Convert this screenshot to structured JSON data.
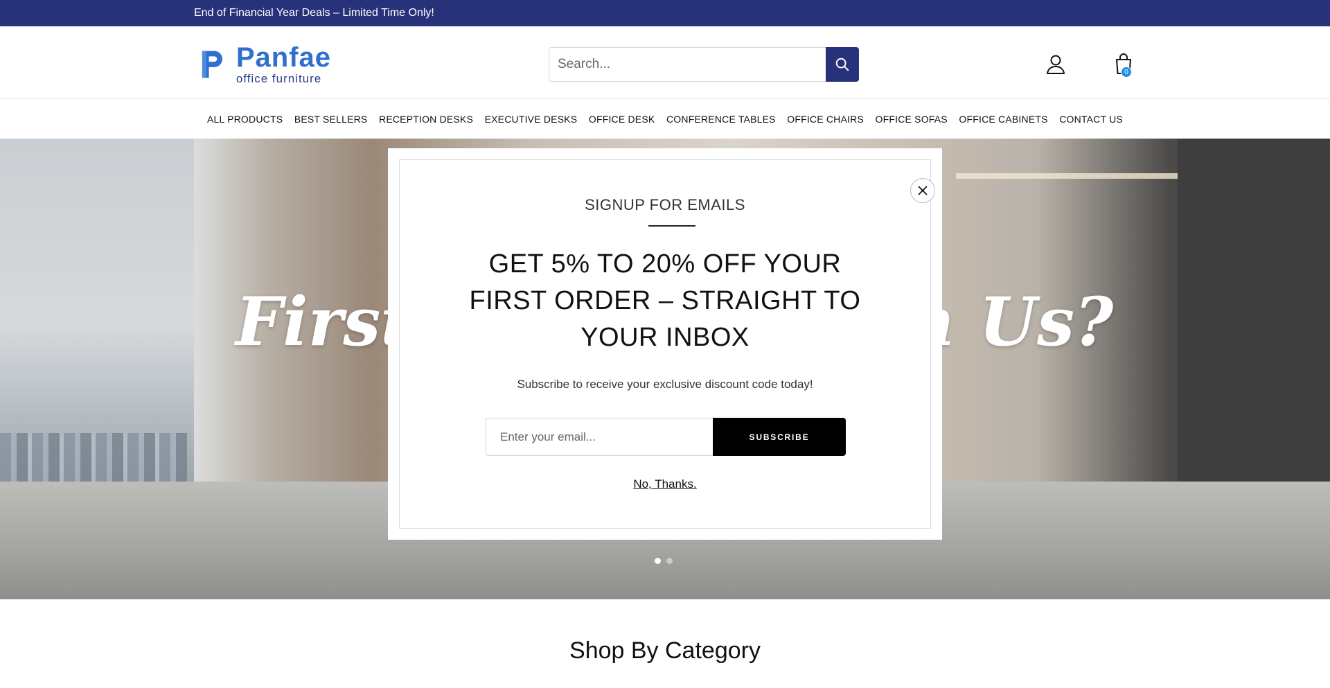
{
  "announcement": {
    "text": "End of Financial Year Deals – Limited Time Only!"
  },
  "brand": {
    "name": "Panfae",
    "tagline": "office furniture",
    "colors": {
      "primary": "#28327a",
      "logo": "#2f6fcf"
    }
  },
  "search": {
    "placeholder": "Search...",
    "icon": "search-icon"
  },
  "header_icons": {
    "account": "account-icon",
    "cart": "cart-icon",
    "cart_count": "0"
  },
  "nav": {
    "items": [
      {
        "label": "ALL PRODUCTS"
      },
      {
        "label": "BEST SELLERS"
      },
      {
        "label": "RECEPTION DESKS"
      },
      {
        "label": "EXECUTIVE DESKS"
      },
      {
        "label": "OFFICE DESK"
      },
      {
        "label": "CONFERENCE TABLES"
      },
      {
        "label": "OFFICE CHAIRS"
      },
      {
        "label": "OFFICE SOFAS"
      },
      {
        "label": "OFFICE CABINETS"
      },
      {
        "label": "CONTACT US"
      }
    ]
  },
  "hero": {
    "text_left": "First",
    "text_right": "h Us?",
    "slide_count": 2,
    "active_slide": 1
  },
  "popup": {
    "kicker": "SIGNUP FOR EMAILS",
    "headline_lines": [
      "GET 5% TO 20% OFF YOUR",
      "FIRST ORDER – STRAIGHT TO",
      "YOUR INBOX"
    ],
    "subtext": "Subscribe to receive your exclusive discount code today!",
    "email_placeholder": "Enter your email...",
    "subscribe_label": "SUBSCRIBE",
    "dismiss_label": "No, Thanks.",
    "close_icon": "close-icon"
  },
  "sections": {
    "shop_by_category": "Shop By Category"
  }
}
